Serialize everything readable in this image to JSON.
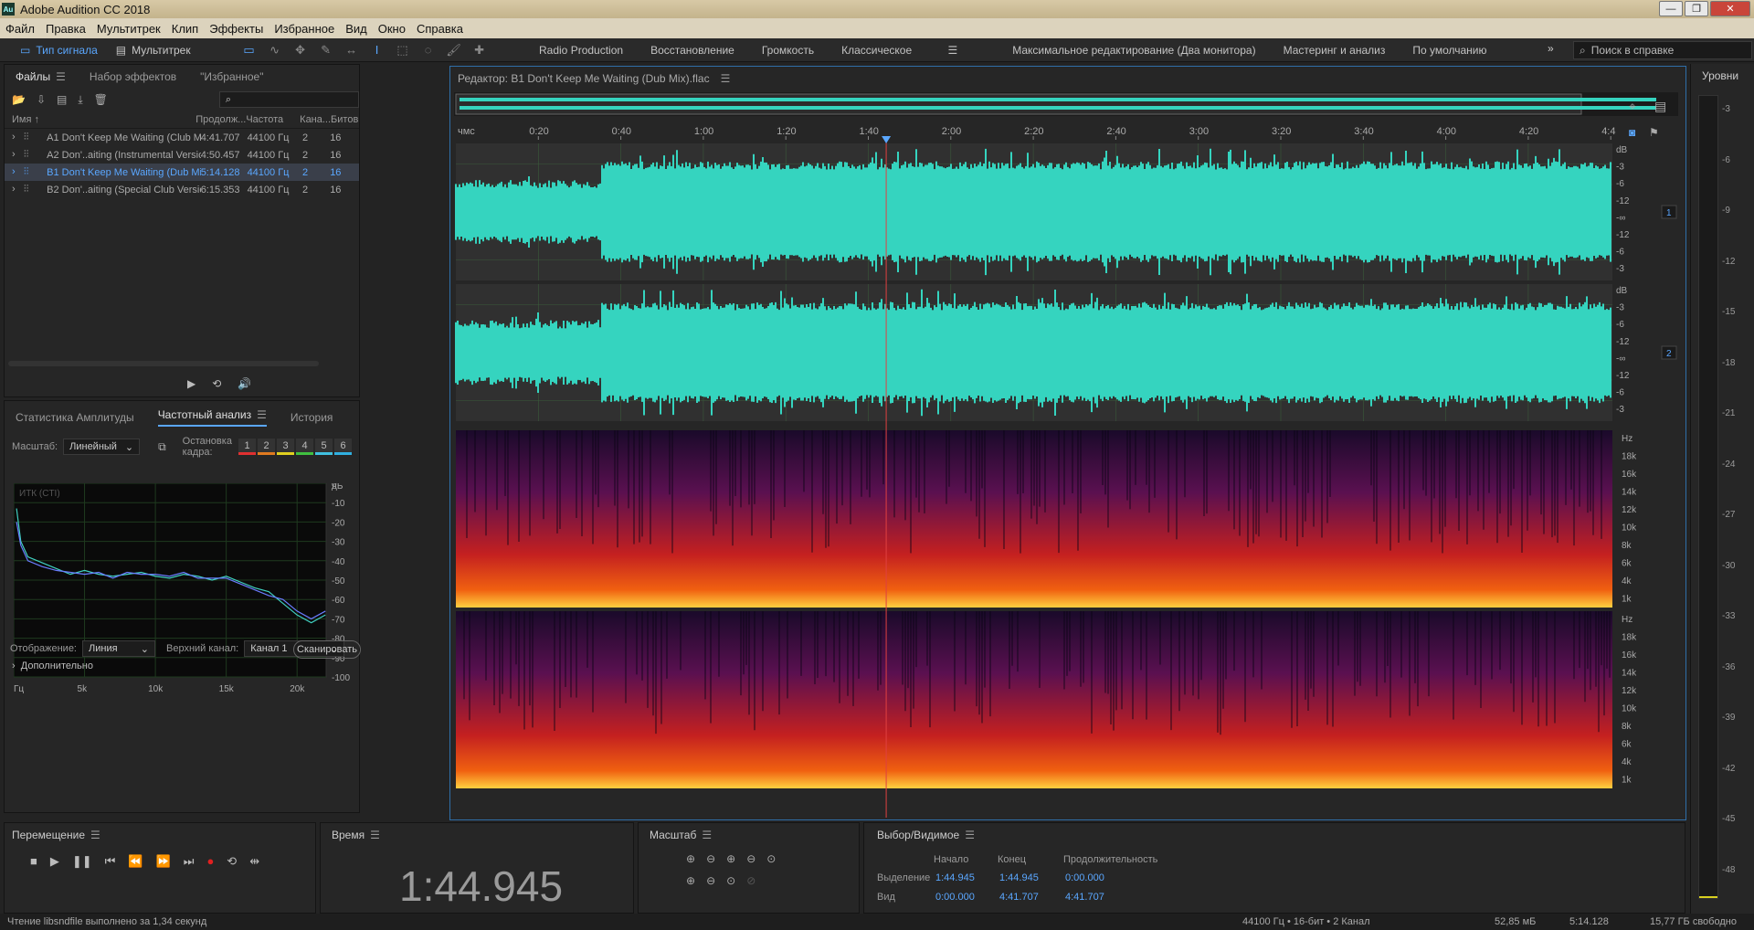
{
  "window": {
    "title": "Adobe Audition CC 2018",
    "logo": "Au"
  },
  "menu": [
    "Файл",
    "Правка",
    "Мультитрек",
    "Клип",
    "Эффекты",
    "Избранное",
    "Вид",
    "Окно",
    "Справка"
  ],
  "mode": {
    "waveform": "Тип сигнала",
    "multitrack": "Мультитрек"
  },
  "workspaces": [
    "Radio Production",
    "Восстановление",
    "Громкость",
    "Классическое",
    "Максимальное редактирование (Два монитора)",
    "Мастеринг и анализ",
    "По умолчанию"
  ],
  "help_search": "Поиск в справке",
  "files_panel": {
    "tabs": [
      "Файлы",
      "Набор эффектов",
      "\"Избранное\""
    ],
    "columns": [
      "Имя",
      "Продолж...",
      "Частота",
      "Кана...",
      "Битов"
    ],
    "rows": [
      {
        "name": "A1 Don't Keep Me Waiting (Club Mix).flac",
        "duration": "4:41.707",
        "rate": "44100 Гц",
        "ch": "2",
        "bits": "16"
      },
      {
        "name": "A2 Don'..aiting (Instrumental Version).flac",
        "duration": "4:50.457",
        "rate": "44100 Гц",
        "ch": "2",
        "bits": "16"
      },
      {
        "name": "B1 Don't Keep Me Waiting (Dub Mix).flac",
        "duration": "5:14.128",
        "rate": "44100 Гц",
        "ch": "2",
        "bits": "16"
      },
      {
        "name": "B2 Don'..aiting (Special Club Version).flac",
        "duration": "6:15.353",
        "rate": "44100 Гц",
        "ch": "2",
        "bits": "16"
      }
    ]
  },
  "freq_panel": {
    "tabs": [
      "Статистика Амплитуды",
      "Частотный анализ",
      "История"
    ],
    "scale_label": "Масштаб:",
    "scale_value": "Линейный",
    "freeze_label": "Остановка кадра:",
    "freeze_buttons": [
      "1",
      "2",
      "3",
      "4",
      "5",
      "6"
    ],
    "freeze_colors": [
      "#e03030",
      "#e07a20",
      "#e0d020",
      "#40c040",
      "#40c0e0",
      "#30b0e0"
    ],
    "chart_label": "ИТК (CTI)",
    "display_label": "Отображение:",
    "display_value": "Линия",
    "channel_label": "Верхний канал:",
    "channel_value": "Канал 1",
    "scan_button": "Сканировать",
    "advanced": "Дополнительно"
  },
  "chart_data": {
    "type": "line",
    "xlabel": "Гц",
    "x_ticks": [
      "Гц",
      "5k",
      "10k",
      "15k",
      "20k"
    ],
    "y_unit": "дБ",
    "y_ticks": [
      "0",
      "-10",
      "-20",
      "-30",
      "-40",
      "-50",
      "-60",
      "-70",
      "-80",
      "-90",
      "-100"
    ],
    "xlim": [
      0,
      22050
    ],
    "ylim": [
      -100,
      0
    ],
    "series": [
      {
        "color": "#40d0c0",
        "x": [
          200,
          500,
          1000,
          2000,
          3000,
          4000,
          5000,
          6000,
          7000,
          8000,
          9000,
          10000,
          11000,
          12000,
          13000,
          14000,
          15000,
          16000,
          17000,
          18000,
          19000,
          20000,
          21000,
          22000
        ],
        "values": [
          -13,
          -30,
          -38,
          -41,
          -44,
          -47,
          -45,
          -47,
          -48,
          -47,
          -46,
          -48,
          -49,
          -47,
          -48,
          -50,
          -48,
          -51,
          -54,
          -56,
          -62,
          -68,
          -72,
          -68
        ]
      },
      {
        "color": "#6a7cff",
        "x": [
          200,
          500,
          1000,
          2000,
          3000,
          4000,
          5000,
          6000,
          7000,
          8000,
          9000,
          10000,
          11000,
          12000,
          13000,
          14000,
          15000,
          16000,
          17000,
          18000,
          19000,
          20000,
          21000,
          22000
        ],
        "values": [
          -20,
          -32,
          -40,
          -43,
          -45,
          -46,
          -47,
          -46,
          -49,
          -46,
          -47,
          -47,
          -48,
          -46,
          -49,
          -49,
          -49,
          -52,
          -55,
          -58,
          -60,
          -66,
          -70,
          -66
        ]
      }
    ]
  },
  "editor": {
    "title": "Редактор: B1 Don't Keep Me Waiting (Dub Mix).flac",
    "ruler": [
      "чмс",
      "0:20",
      "0:40",
      "1:00",
      "1:20",
      "1:40",
      "2:00",
      "2:20",
      "2:40",
      "3:00",
      "3:20",
      "3:40",
      "4:00",
      "4:20",
      "4:4"
    ],
    "db_scale": [
      "dB",
      "-3",
      "-6",
      "-12",
      "-∞",
      "-12",
      "-6",
      "-3"
    ],
    "channels": [
      "1",
      "2"
    ],
    "hz_scale": [
      "Hz",
      "18k",
      "16k",
      "14k",
      "12k",
      "10k",
      "8k",
      "6k",
      "4k",
      "1k"
    ],
    "playhead_fraction": 0.3721
  },
  "transport": {
    "title": "Перемещение"
  },
  "time": {
    "title": "Время",
    "value": "1:44.945"
  },
  "zoom": {
    "title": "Масштаб"
  },
  "selection": {
    "title": "Выбор/Видимое",
    "cols": [
      "Начало",
      "Конец",
      "Продолжительность"
    ],
    "rows": [
      {
        "label": "Выделение",
        "start": "1:44.945",
        "end": "1:44.945",
        "dur": "0:00.000"
      },
      {
        "label": "Вид",
        "start": "0:00.000",
        "end": "4:41.707",
        "dur": "4:41.707"
      }
    ]
  },
  "levels": {
    "title": "Уровни",
    "ticks": [
      "-3",
      "-6",
      "-9",
      "-12",
      "-15",
      "-18",
      "-21",
      "-24",
      "-27",
      "-30",
      "-33",
      "-36",
      "-39",
      "-42",
      "-45",
      "-48"
    ]
  },
  "status": {
    "left": "Чтение libsndfile выполнено за 1,34 секунд",
    "format": "44100 Гц • 16-бит • 2 Канал",
    "size": "52,85 мБ",
    "duration": "5:14.128",
    "free": "15,77 ГБ свободно"
  },
  "colors": {
    "accent": "#5aa7ff",
    "wave": "#35d4bf",
    "record": "#e02020"
  }
}
